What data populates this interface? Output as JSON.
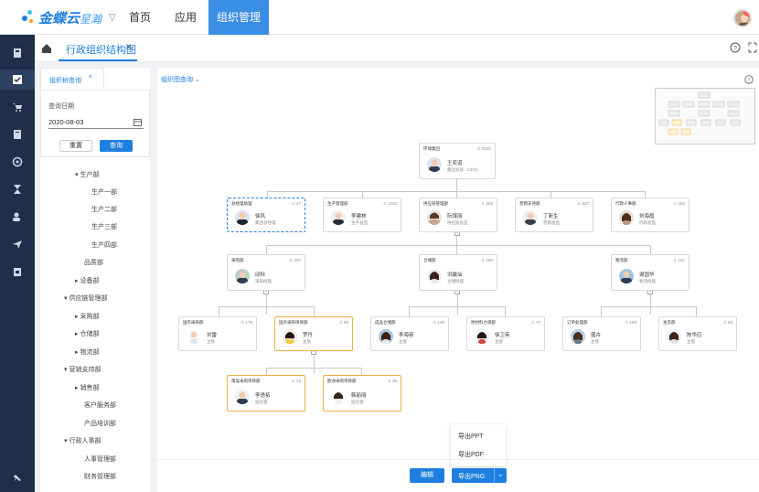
{
  "topbar": {
    "logo_name": "金蝶云",
    "logo_sub": "星瀚",
    "nav": [
      {
        "label": "首页"
      },
      {
        "label": "应用"
      },
      {
        "label": "组织管理"
      }
    ]
  },
  "tabbar": {
    "tab_title": "行政组织结构图"
  },
  "query_panel": {
    "header": "组织树查询",
    "date_label": "查询日期",
    "date_value": "2020-08-03",
    "reset": "重置",
    "query": "查询"
  },
  "tree": [
    {
      "label": "生产部"
    },
    {
      "label": "生产一部"
    },
    {
      "label": "生产二部"
    },
    {
      "label": "生产三部"
    },
    {
      "label": "生产四部"
    },
    {
      "label": "品质部"
    },
    {
      "label": "设备部"
    },
    {
      "label": "供应链管理部"
    },
    {
      "label": "采购部"
    },
    {
      "label": "仓储部"
    },
    {
      "label": "物流部"
    },
    {
      "label": "营销支持部"
    },
    {
      "label": "销售部"
    },
    {
      "label": "客户服务部"
    },
    {
      "label": "产品培训部"
    },
    {
      "label": "行政人事部"
    },
    {
      "label": "人事管理部"
    },
    {
      "label": "财务管理部"
    }
  ],
  "chart_header": "组织图查询",
  "org": [
    {
      "dept": "环球集团",
      "count": "3150",
      "name": "王奕道",
      "role": "集团总裁（CEO）"
    },
    {
      "dept": "总经理助理",
      "count": "27",
      "name": "徐风",
      "role": "集团总经理"
    },
    {
      "dept": "生产管理部",
      "count": "1232",
      "name": "李建林",
      "role": "生产总监"
    },
    {
      "dept": "供应链管理部",
      "count": "599",
      "name": "阮煤丽",
      "role": "供应链总监"
    },
    {
      "dept": "营销支持部",
      "count": "627",
      "name": "丁新生",
      "role": "营销总监"
    },
    {
      "dept": "行政人事部",
      "count": "264",
      "name": "刘海霞",
      "role": "行政总监"
    },
    {
      "dept": "采购部",
      "count": "237",
      "name": "邱科",
      "role": "采购经理"
    },
    {
      "dept": "仓储部",
      "count": "192",
      "name": "洪赢仙",
      "role": "仓储经理"
    },
    {
      "dept": "物流部",
      "count": "161",
      "name": "谢国华",
      "role": "物流经理"
    },
    {
      "dept": "国内采购部",
      "count": "178",
      "name": "刘雷",
      "role": "主管"
    },
    {
      "dept": "国外采购项目部",
      "count": "59",
      "name": "罗丹",
      "role": "主管"
    },
    {
      "dept": "成品仓储部",
      "count": "120",
      "name": "李海容",
      "role": "主管"
    },
    {
      "dept": "原材料仓储部",
      "count": "72",
      "name": "徐卫英",
      "role": "主管"
    },
    {
      "dept": "订单处理部",
      "count": "103",
      "name": "盛卉",
      "role": "主管"
    },
    {
      "dept": "发货部",
      "count": "58",
      "name": "陈华应",
      "role": "主管"
    },
    {
      "dept": "南美采购项目部",
      "count": "23",
      "name": "李语拓",
      "role": "副主管"
    },
    {
      "dept": "欧洲采购项目部",
      "count": "36",
      "name": "韩丽丽",
      "role": "副主管"
    }
  ],
  "export_menu": {
    "ppt": "导出PPT",
    "pdf": "导出PDF"
  },
  "bottom": {
    "edit": "编辑",
    "export_png": "导出PNG"
  },
  "colors": {
    "accent": "#1f7fe0",
    "sidebar": "#1f2f4a",
    "highlight": "#f0b040"
  }
}
